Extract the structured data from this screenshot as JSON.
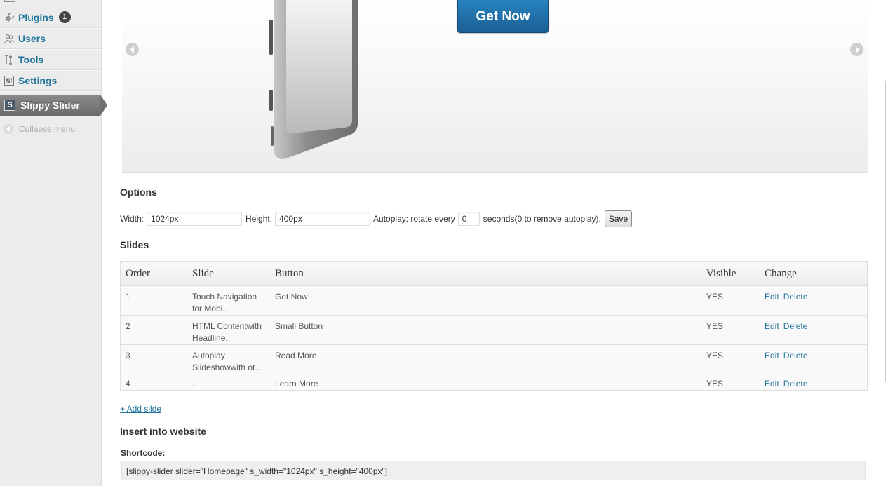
{
  "sidebar": {
    "items": [
      {
        "label": "Plugins",
        "icon": "plug-icon",
        "badge": "1"
      },
      {
        "label": "Users",
        "icon": "users-icon"
      },
      {
        "label": "Tools",
        "icon": "tools-icon"
      },
      {
        "label": "Settings",
        "icon": "settings-icon"
      }
    ],
    "active": {
      "label": "Slippy Slider",
      "icon": "slippy-slider-icon",
      "icon_glyph": "S"
    },
    "collapse_label": "Collapse menu"
  },
  "slider_preview": {
    "button_label": "Get Now"
  },
  "options": {
    "heading": "Options",
    "width_label": "Width:",
    "width_value": "1024px",
    "height_label": "Height:",
    "height_value": "400px",
    "autoplay_label": "Autoplay: rotate every",
    "autoplay_value": "0",
    "autoplay_suffix": "seconds(0 to remove autoplay).",
    "save_label": "Save"
  },
  "slides": {
    "heading": "Slides",
    "columns": [
      "Order",
      "Slide",
      "Button",
      "Visible",
      "Change"
    ],
    "rows": [
      {
        "order": "1",
        "slide": "Touch Navigation for Mobi..",
        "button": "Get Now",
        "visible": "YES",
        "edit": "Edit",
        "delete": "Delete"
      },
      {
        "order": "2",
        "slide": "HTML Contentwith Headline..",
        "button": "Small Button",
        "visible": "YES",
        "edit": "Edit",
        "delete": "Delete"
      },
      {
        "order": "3",
        "slide": "Autoplay Slideshowwith ot..",
        "button": "Read More",
        "visible": "YES",
        "edit": "Edit",
        "delete": "Delete"
      },
      {
        "order": "4",
        "slide": "..",
        "button": "Learn More",
        "visible": "YES",
        "edit": "Edit",
        "delete": "Delete"
      }
    ],
    "add_label": "+ Add silde"
  },
  "insert": {
    "heading": "Insert into website",
    "shortcode_label": "Shortcode:",
    "shortcode_value": "[slippy-slider slider=\"Homepage\" s_width=\"1024px\" s_height=\"400px\"]"
  },
  "colors": {
    "link": "#21759b",
    "sidebar_bg": "#ececec",
    "active_menu": "#7a7a7a",
    "get_now_button": "#1f6fa8"
  }
}
